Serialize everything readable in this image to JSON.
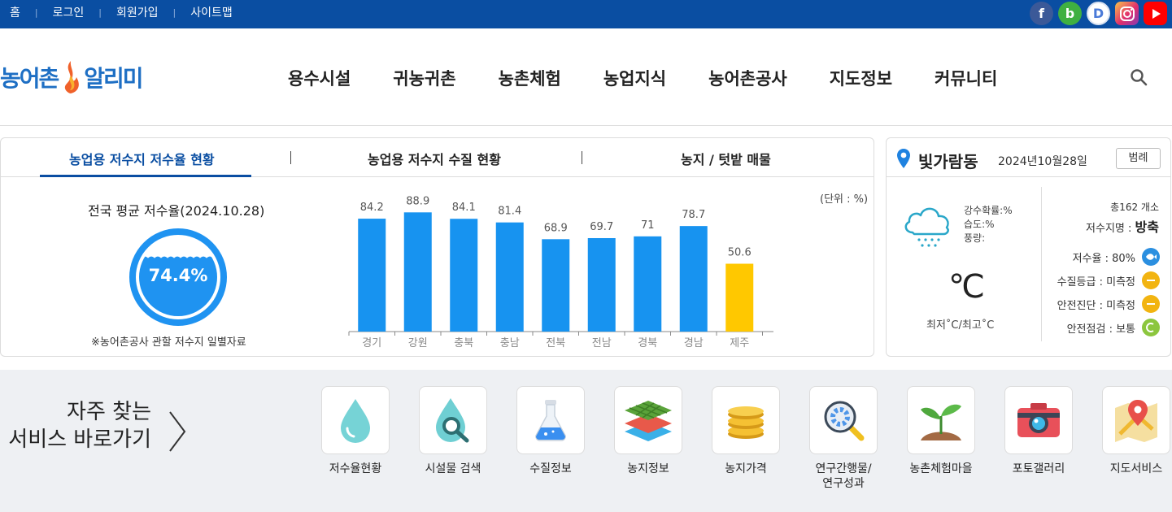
{
  "topbar": {
    "links": [
      "홈",
      "로그인",
      "회원가입",
      "사이트맵"
    ],
    "social": [
      "facebook-icon",
      "blog-icon",
      "daum-icon",
      "instagram-icon",
      "youtube-icon"
    ]
  },
  "header": {
    "logo_text_1": "농어촌",
    "logo_text_2": "알리미",
    "nav": [
      "용수시설",
      "귀농귀촌",
      "농촌체험",
      "농업지식",
      "농어촌공사",
      "지도정보",
      "커뮤니티"
    ]
  },
  "reservoir": {
    "tabs": [
      "농업용 저수지 저수율 현황",
      "농업용 저수지 수질 현황",
      "농지 / 텃밭 매물"
    ],
    "avg_title": "전국 평균 저수율(2024.10.28)",
    "avg_value": "74.4%",
    "avg_fraction": 0.744,
    "note": "※농어촌공사 관할 저수지 일별자료",
    "unit": "(단위 : %)"
  },
  "chart_data": {
    "type": "bar",
    "categories": [
      "경기",
      "강원",
      "충북",
      "충남",
      "전북",
      "전남",
      "경북",
      "경남",
      "제주"
    ],
    "values": [
      84.2,
      88.9,
      84.1,
      81.4,
      68.9,
      69.7,
      71,
      78.7,
      50.6
    ],
    "value_labels": [
      "84.2",
      "88.9",
      "84.1",
      "81.4",
      "68.9",
      "69.7",
      "71",
      "78.7",
      "50.6"
    ],
    "colors": [
      "#1793f0",
      "#1793f0",
      "#1793f0",
      "#1793f0",
      "#1793f0",
      "#1793f0",
      "#1793f0",
      "#1793f0",
      "#ffc800"
    ],
    "ylim": [
      0,
      100
    ],
    "grid": false
  },
  "weather": {
    "location": "빛가람동",
    "date": "2024년10월28일",
    "legend_button": "범례",
    "lines": [
      "강수확률:%",
      "습도:%",
      "풍량:"
    ],
    "temp": "℃",
    "minmax": "최저˚C/최고˚C",
    "total": "총162 개소",
    "reservoir_label": "저수지명 :",
    "reservoir_name": "방축",
    "status": [
      {
        "label": "저수율 : 80%",
        "color": "blue"
      },
      {
        "label": "수질등급 : 미측정",
        "color": "yellow"
      },
      {
        "label": "안전진단 : 미측정",
        "color": "yellow"
      },
      {
        "label": "안전점검 : 보통",
        "color": "green"
      }
    ]
  },
  "shortcuts": {
    "title_line1": "자주 찾는",
    "title_line2": "서비스 바로가기",
    "items": [
      {
        "label": "저수율현황",
        "icon": "water-drop-icon"
      },
      {
        "label": "시설물 검색",
        "icon": "drop-search-icon"
      },
      {
        "label": "수질정보",
        "icon": "flask-icon"
      },
      {
        "label": "농지정보",
        "icon": "farmland-layers-icon"
      },
      {
        "label": "농지가격",
        "icon": "coins-icon"
      },
      {
        "label": "연구간행물/\n연구성과",
        "icon": "gear-magnifier-icon"
      },
      {
        "label": "농촌체험마을",
        "icon": "sprout-icon"
      },
      {
        "label": "포토갤러리",
        "icon": "camera-icon"
      },
      {
        "label": "지도서비스",
        "icon": "map-pin-icon"
      }
    ]
  }
}
